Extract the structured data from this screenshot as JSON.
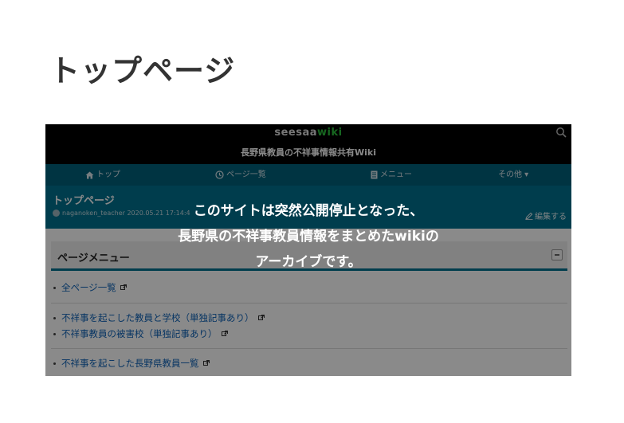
{
  "page_title": "トップページ",
  "site": {
    "logo_part1": "seesaa",
    "logo_part2": "wiki",
    "title": "長野県教員の不祥事情報共有Wiki"
  },
  "nav": {
    "items": [
      {
        "label": "トップ",
        "icon": "home-icon"
      },
      {
        "label": "ページ一覧",
        "icon": "clock-icon"
      },
      {
        "label": "メニュー",
        "icon": "document-icon"
      },
      {
        "label": "その他 ▾",
        "icon": "caret-down-icon"
      }
    ]
  },
  "wiki_page": {
    "title": "トップページ",
    "meta": "naganoken_teacher 2020.05.21 17:14:4",
    "edit_label": "編集する"
  },
  "menu": {
    "title": "ページメニュー",
    "items": [
      "全ページ一覧",
      "不祥事を起こした教員と学校（単独記事あり）",
      "不祥事教員の被害校（単独記事あり）",
      "不祥事を起こした長野県教員一覧"
    ]
  },
  "notice": {
    "line1": "このサイトは突然公開停止となった、",
    "line2": "長野県の不祥事教員情報をまとめたwikiの",
    "line3": "アーカイブです。"
  },
  "colors": {
    "nav_bg": "#00607a",
    "title_bg": "#00728f",
    "link": "#0f63b8",
    "logo_green": "#2bbf3c"
  }
}
